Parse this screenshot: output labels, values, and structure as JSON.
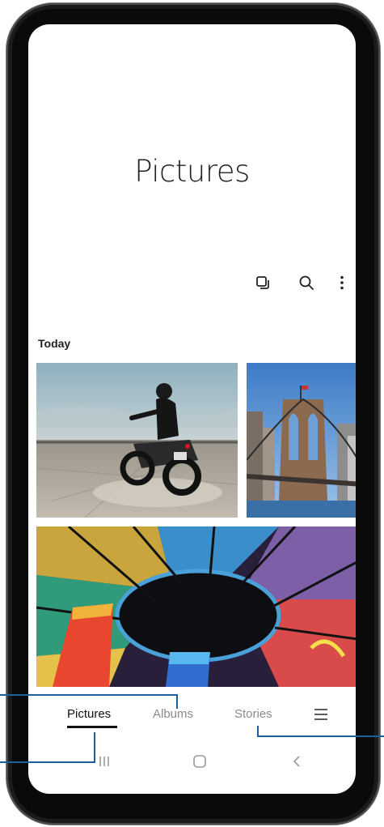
{
  "header": {
    "title": "Pictures"
  },
  "toolbar": {
    "icons": [
      "select-icon",
      "search-icon",
      "more-options-icon"
    ]
  },
  "content": {
    "section_label": "Today",
    "photos": [
      {
        "name": "motorcycle-photo"
      },
      {
        "name": "bridge-photo"
      },
      {
        "name": "stained-glass-photo"
      }
    ]
  },
  "bottom_tabs": {
    "items": [
      {
        "label": "Pictures",
        "active": true
      },
      {
        "label": "Albums",
        "active": false
      },
      {
        "label": "Stories",
        "active": false
      }
    ],
    "menu_icon": "menu-icon"
  },
  "nav_bar": {
    "icons": [
      "recents-icon",
      "home-icon",
      "back-icon"
    ]
  },
  "colors": {
    "callout": "#1d5f9b",
    "frame": "#1b1b1b",
    "screen": "#ffffff"
  }
}
